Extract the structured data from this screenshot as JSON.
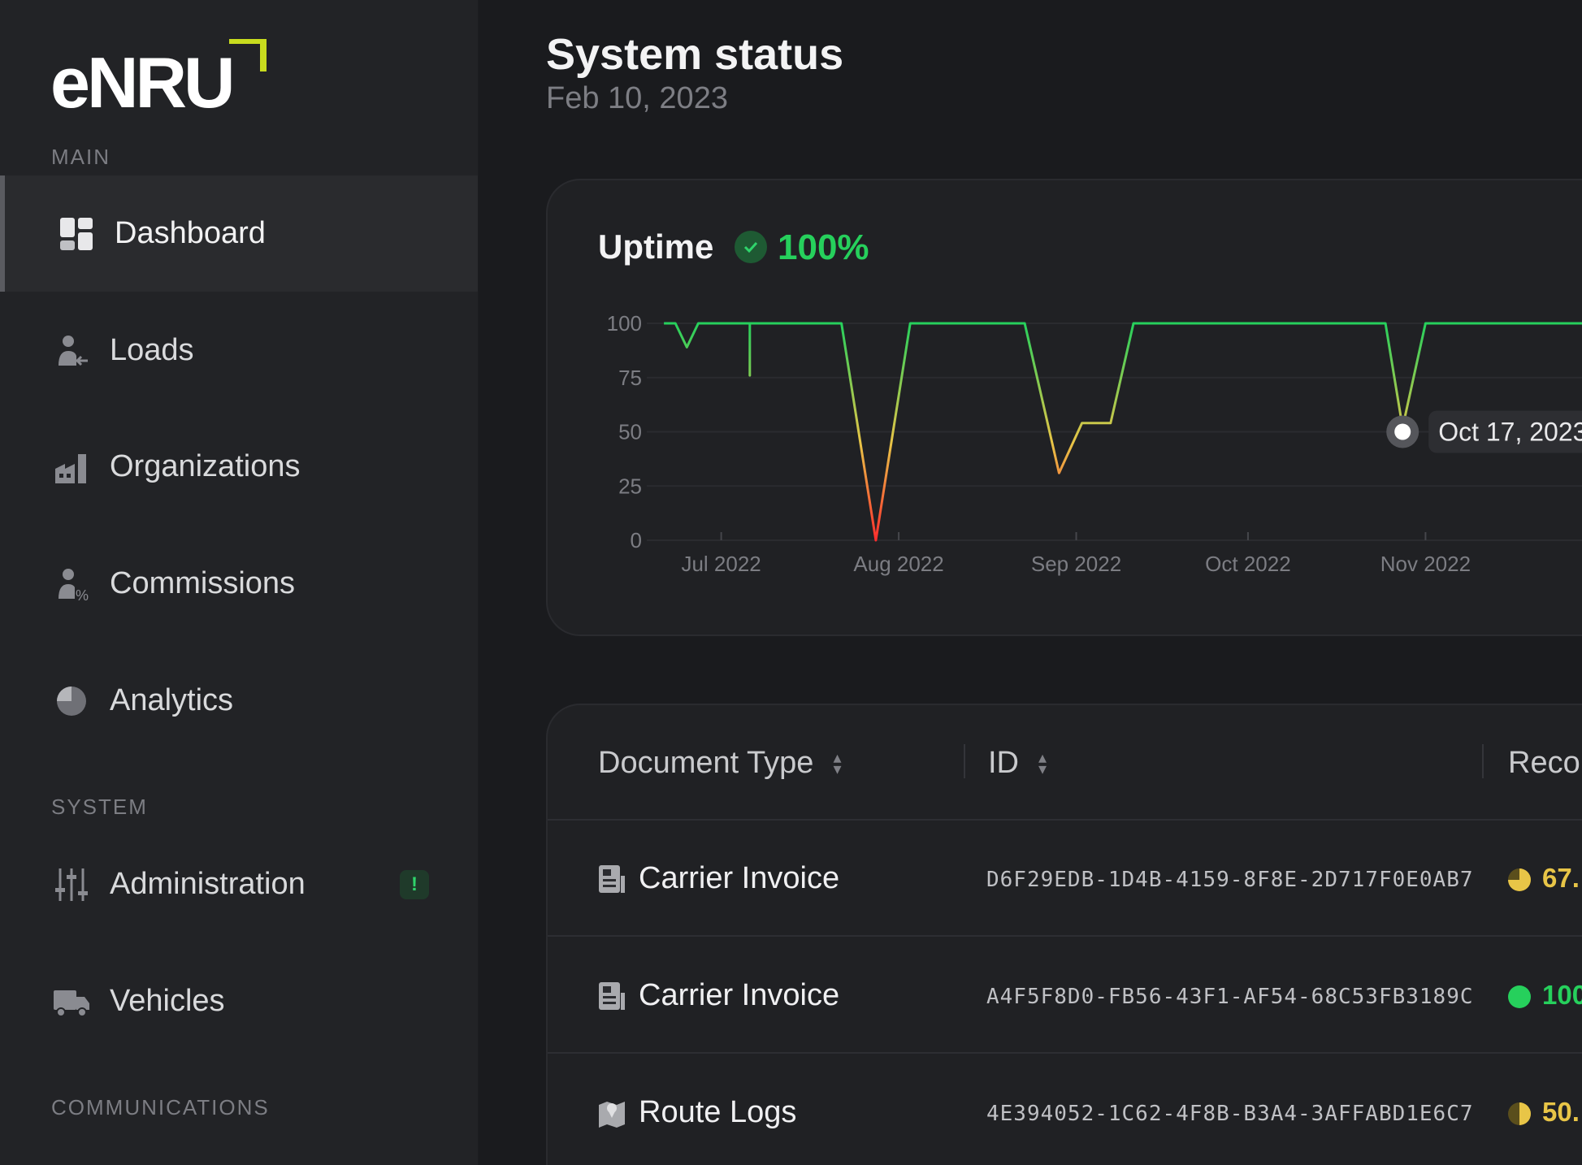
{
  "app": {
    "logo_text": "eNRU"
  },
  "sidebar": {
    "sections": {
      "main": "MAIN",
      "system": "SYSTEM",
      "communications": "COMMUNICATIONS"
    },
    "items": [
      {
        "label": "Dashboard",
        "icon": "dashboard-icon",
        "active": true
      },
      {
        "label": "Loads",
        "icon": "loads-icon"
      },
      {
        "label": "Organizations",
        "icon": "organizations-icon"
      },
      {
        "label": "Commissions",
        "icon": "commissions-icon"
      },
      {
        "label": "Analytics",
        "icon": "analytics-icon"
      },
      {
        "label": "Administration",
        "icon": "administration-icon",
        "badge": "!"
      },
      {
        "label": "Vehicles",
        "icon": "vehicles-icon"
      }
    ]
  },
  "header": {
    "title": "System status",
    "date": "Feb 10, 2023"
  },
  "uptime": {
    "title": "Uptime",
    "value": "100%",
    "tooltip": "Oct 17, 2023"
  },
  "chart_data": {
    "type": "line",
    "title": "Uptime",
    "ylim": [
      0,
      100
    ],
    "yticks": [
      0,
      25,
      50,
      75,
      100
    ],
    "xticks": [
      "Jul 2022",
      "Aug 2022",
      "Sep 2022",
      "Oct 2022",
      "Nov 2022"
    ],
    "grid": true,
    "series": [
      {
        "points": [
          {
            "x": "2022-06-21",
            "y": 100
          },
          {
            "x": "2022-06-23",
            "y": 100
          },
          {
            "x": "2022-06-25",
            "y": 89
          },
          {
            "x": "2022-06-27",
            "y": 100
          },
          {
            "x": "2022-07-06",
            "y": 100
          },
          {
            "x": "2022-07-06",
            "y": 76
          },
          {
            "x": "2022-07-06",
            "y": 100
          },
          {
            "x": "2022-07-22",
            "y": 100
          },
          {
            "x": "2022-07-28",
            "y": 0
          },
          {
            "x": "2022-08-03",
            "y": 100
          },
          {
            "x": "2022-08-23",
            "y": 100
          },
          {
            "x": "2022-08-29",
            "y": 31
          },
          {
            "x": "2022-09-02",
            "y": 54
          },
          {
            "x": "2022-09-07",
            "y": 54
          },
          {
            "x": "2022-09-11",
            "y": 100
          },
          {
            "x": "2022-10-25",
            "y": 100
          },
          {
            "x": "2022-10-28",
            "y": 52
          },
          {
            "x": "2022-11-01",
            "y": 100
          },
          {
            "x": "2022-12-01",
            "y": 100
          }
        ]
      }
    ],
    "highlight": {
      "x": "2022-10-28",
      "y": 50,
      "label": "Oct 17, 2023"
    }
  },
  "table": {
    "columns": [
      "Document Type",
      "ID",
      "Reco"
    ],
    "rows": [
      {
        "type": "Carrier Invoice",
        "id": "D6F29EDB-1D4B-4159-8F8E-2D717F0E0AB7",
        "record": "67.",
        "record_color": "#e8c547",
        "icon": "invoice-icon",
        "record_icon": "three-quarter-pie-icon"
      },
      {
        "type": "Carrier Invoice",
        "id": "A4F5F8D0-FB56-43F1-AF54-68C53FB3189C",
        "record": "100",
        "record_color": "#26d05c",
        "icon": "invoice-icon",
        "record_icon": "full-circle-icon"
      },
      {
        "type": "Route Logs",
        "id": "4E394052-1C62-4F8B-B3A4-3AFFABD1E6C7",
        "record": "50.",
        "record_color": "#e8c547",
        "icon": "map-pin-icon",
        "record_icon": "half-pie-icon"
      }
    ]
  },
  "colors": {
    "good": "#26d05c",
    "warn": "#e8c547",
    "bad": "#ff3b3b",
    "accent_logo": "#c8dc1e"
  }
}
